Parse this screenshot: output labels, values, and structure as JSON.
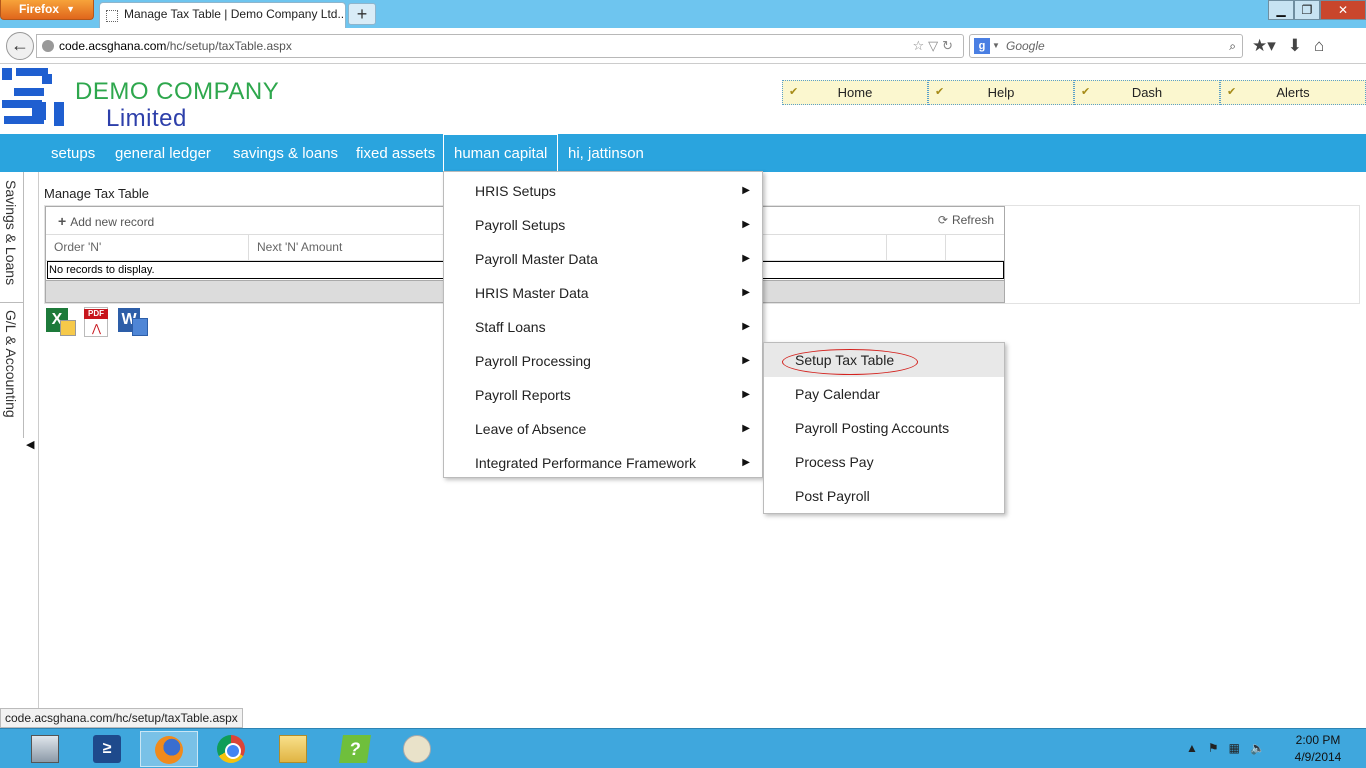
{
  "browser": {
    "app_button": "Firefox",
    "tab_title": "Manage Tax Table | Demo Company Ltd...",
    "url_host": "code.acsghana.com",
    "url_path": "/hc/setup/taxTable.aspx",
    "search_placeholder": "Google",
    "status_url": "code.acsghana.com/hc/setup/taxTable.aspx"
  },
  "header": {
    "company_name": "DEMO COMPANY",
    "company_sub": "Limited"
  },
  "top_menu": [
    "Home",
    "Help",
    "Dash",
    "Alerts"
  ],
  "main_nav": {
    "setups": "setups",
    "general_ledger": "general ledger",
    "savings_loans": "savings & loans",
    "fixed_assets": "fixed assets",
    "human_capital": "human capital",
    "greeting": "hi, jattinson"
  },
  "side_tabs": {
    "savings": "Savings & Loans",
    "gl": "G/L & Accounting"
  },
  "page": {
    "heading": "Manage Tax Table",
    "add_record": "Add new record",
    "refresh": "Refresh",
    "columns": [
      "Order 'N'",
      "Next 'N' Amount"
    ],
    "no_records": "No records to display."
  },
  "dropdown": {
    "items": [
      "HRIS Setups",
      "Payroll Setups",
      "Payroll Master Data",
      "HRIS Master Data",
      "Staff Loans",
      "Payroll Processing",
      "Payroll Reports",
      "Leave of Absence",
      "Integrated Performance Framework"
    ]
  },
  "submenu": {
    "items": [
      "Setup Tax Table",
      "Pay Calendar",
      "Payroll Posting Accounts",
      "Process Pay",
      "Post Payroll"
    ]
  },
  "export": {
    "pdf_label": "PDF",
    "excel_letter": "X",
    "word_letter": "W"
  },
  "taskbar": {
    "time": "2:00 PM",
    "date": "4/9/2014",
    "apps": [
      "server-manager-icon",
      "powershell-icon",
      "firefox-icon",
      "chrome-icon",
      "file-explorer-icon",
      "help-app-icon",
      "paint-icon"
    ],
    "active_app": "firefox-icon"
  },
  "colors": {
    "nav_blue": "#2aa4de",
    "company_green": "#2ea74d",
    "company_blue": "#2d3faa",
    "highlight_circle": "#d3221e"
  }
}
